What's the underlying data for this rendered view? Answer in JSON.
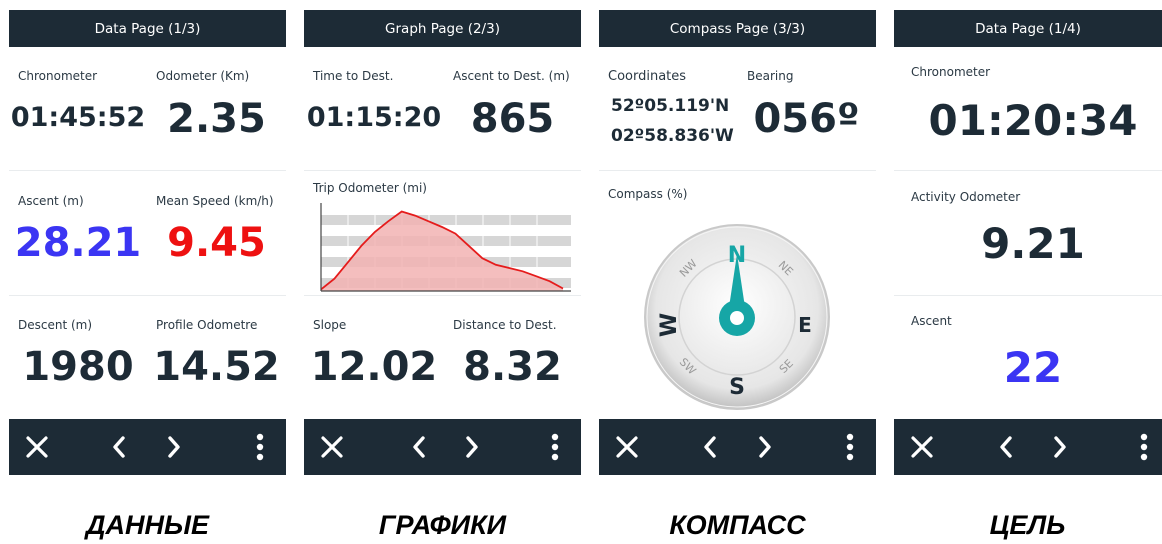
{
  "colors": {
    "bar": "#1d2b36",
    "blue": "#3b35f3",
    "red": "#ee1111",
    "teal": "#16a6a6",
    "graph_fill": "#f2b3b3",
    "graph_line": "#e51c1c"
  },
  "screens": [
    {
      "title": "Data Page (1/3)",
      "fields": [
        {
          "label": "Chronometer",
          "value": "01:45:52"
        },
        {
          "label": "Odometer (Km)",
          "value": "2.35"
        },
        {
          "label": "Ascent (m)",
          "value": "28.21"
        },
        {
          "label": "Mean Speed (km/h)",
          "value": "9.45"
        },
        {
          "label": "Descent (m)",
          "value": "1980"
        },
        {
          "label": "Profile Odometre",
          "value": "14.52"
        }
      ],
      "caption": "ДАННЫЕ"
    },
    {
      "title": "Graph Page (2/3)",
      "fields": [
        {
          "label": "Time to Dest.",
          "value": "01:15:20"
        },
        {
          "label": "Ascent to Dest. (m)",
          "value": "865"
        },
        {
          "label": "Slope",
          "value": "12.02"
        },
        {
          "label": "Distance to Dest.",
          "value": "8.32"
        }
      ],
      "graph_label": "Trip Odometer (mi)",
      "caption": "ГРАФИКИ"
    },
    {
      "title": "Compass Page (3/3)",
      "coord_label": "Coordinates",
      "lat": "52º05.119'N",
      "lon": "02º58.836'W",
      "bearing_label": "Bearing",
      "bearing": "056º",
      "compass_label": "Compass (%)",
      "cardinals": {
        "n": "N",
        "s": "S",
        "e": "E",
        "w": "W",
        "nw": "NW",
        "ne": "NE",
        "sw": "SW",
        "se": "SE"
      },
      "caption": "КОМПАСС"
    },
    {
      "title": "Data Page (1/4)",
      "fields": [
        {
          "label": "Chronometer",
          "value": "01:20:34"
        },
        {
          "label": "Activity Odometer",
          "value": "9.21"
        },
        {
          "label": "Ascent",
          "value": "22"
        }
      ],
      "caption": "ЦЕЛЬ"
    }
  ],
  "toolbar_icons": [
    "close-icon",
    "chevron-left-icon",
    "chevron-right-icon",
    "more-vertical-icon"
  ],
  "trip_profile": [
    0.02,
    0.15,
    0.35,
    0.55,
    0.72,
    0.85,
    0.97,
    0.92,
    0.85,
    0.78,
    0.7,
    0.55,
    0.4,
    0.32,
    0.28,
    0.24,
    0.18,
    0.12,
    0.03
  ]
}
